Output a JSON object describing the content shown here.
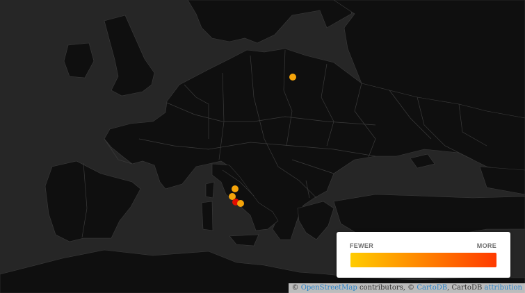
{
  "colors": {
    "sea": "#262626",
    "land": "#0f0f0f",
    "border": "#3b3b3b",
    "marker_fewer": "#f5a40a",
    "marker_more": "#e10d00",
    "scale_start": "#ffcc00",
    "scale_end": "#ff3a00"
  },
  "markers": [
    {
      "place": "Poland",
      "level": "fewer",
      "icon": "circle-marker-icon"
    },
    {
      "place": "Italy (north)",
      "level": "fewer",
      "icon": "circle-marker-icon"
    },
    {
      "place": "Italy (west)",
      "level": "fewer",
      "icon": "circle-marker-icon"
    },
    {
      "place": "Rome",
      "level": "more",
      "icon": "circle-marker-icon"
    },
    {
      "place": "Italy (east)",
      "level": "fewer",
      "icon": "circle-marker-icon"
    }
  ],
  "legend": {
    "min_label": "FEWER",
    "max_label": "MORE"
  },
  "attribution": {
    "prefix": "© ",
    "osm_link": "OpenStreetMap",
    "contributors": " contributors, © ",
    "cartodb_link": "CartoDB",
    "cartodb_text": ", CartoDB ",
    "attribution_link": "attribution"
  }
}
